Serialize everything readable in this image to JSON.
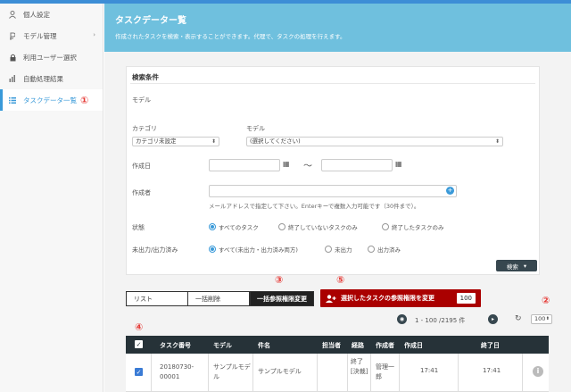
{
  "sidebar": {
    "items": [
      {
        "label": "個人設定",
        "icon": "person-icon"
      },
      {
        "label": "モデル管理",
        "icon": "model-icon"
      },
      {
        "label": "利用ユーザー選択",
        "icon": "lock-icon"
      },
      {
        "label": "自動処理結果",
        "icon": "chart-icon"
      },
      {
        "label": "タスクデータ一覧",
        "icon": "list-icon"
      }
    ]
  },
  "header": {
    "title": "タスクデーター覧",
    "subtitle": "作成されたタスクを検索・表示することができます。代理で、タスクの処理を行えます。"
  },
  "search": {
    "title": "検索条件",
    "model_section_label": "モデル",
    "category_label": "カテゴリ",
    "category_value": "カテゴリ未設定",
    "model_label": "モデル",
    "model_value": "(選択してください)",
    "created_date_label": "作成日",
    "tilde": "〜",
    "creator_label": "作成者",
    "creator_hint": "メールアドレスで指定して下さい。Enterキーで複数入力可能です（30件まで）。",
    "status_label": "状態",
    "status_options": [
      "すべてのタスク",
      "終了していないタスクのみ",
      "終了したタスクのみ"
    ],
    "output_label": "未出力/出力済み",
    "output_options": [
      "すべて(未出力・出力済み両方)",
      "未出力",
      "出力済み"
    ],
    "search_button": "検索"
  },
  "actions": {
    "tab_list": "リスト",
    "tab_bulk_delete": "一括削除",
    "tab_bulk_perm": "一括参照権限変更",
    "change_perm_button": "選択したタスクの参照権限を変更",
    "selected_count": "100"
  },
  "annotations": [
    "①",
    "②",
    "③",
    "④",
    "⑤"
  ],
  "pager": {
    "range": "1 - 100 /2195 件",
    "page_size": "100"
  },
  "table": {
    "headers": [
      "タスク番号",
      "モデル",
      "件名",
      "担当者",
      "経路",
      "作成者",
      "作成日",
      "終了日"
    ],
    "rows": [
      {
        "task_no": "20180730-00001",
        "model": "サンプルモデル",
        "subject": "サンプルモデル",
        "assignee": "",
        "route": "終了[決裁]",
        "creator": "管理一郎",
        "created": "17:41",
        "finished": "17:41"
      }
    ]
  },
  "colors": {
    "header_bg": "#6fc0de",
    "accent": "#3a9ad9",
    "red_button": "#aa0000",
    "annotation": "#e53935",
    "table_header": "#263238"
  }
}
